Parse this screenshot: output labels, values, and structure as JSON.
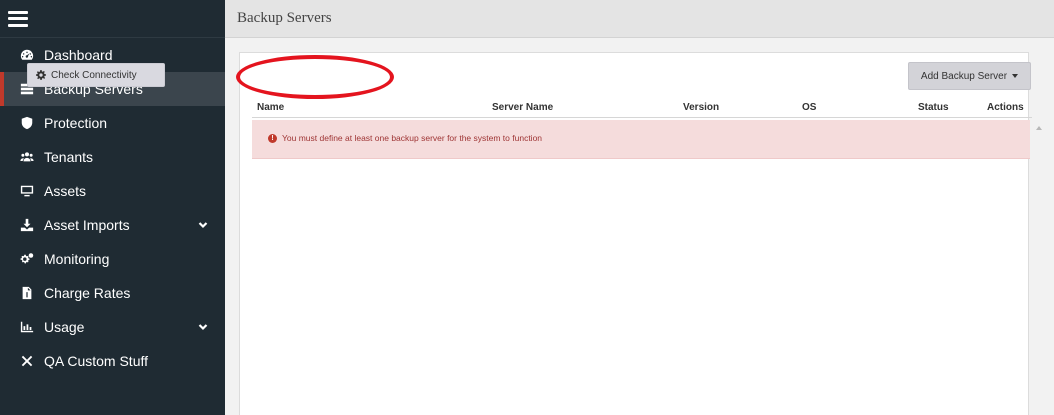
{
  "header": {
    "title": "Backup Servers"
  },
  "sidebar": {
    "items": [
      {
        "label": "Dashboard",
        "icon": "dashboard-icon"
      },
      {
        "label": "Backup Servers",
        "icon": "server-list-icon",
        "active": true
      },
      {
        "label": "Protection",
        "icon": "shield-icon"
      },
      {
        "label": "Tenants",
        "icon": "users-icon"
      },
      {
        "label": "Assets",
        "icon": "monitor-icon"
      },
      {
        "label": "Asset Imports",
        "icon": "download-icon",
        "expandable": true
      },
      {
        "label": "Monitoring",
        "icon": "cogs-icon"
      },
      {
        "label": "Charge Rates",
        "icon": "invoice-icon"
      },
      {
        "label": "Usage",
        "icon": "chart-icon",
        "expandable": true
      },
      {
        "label": "QA Custom Stuff",
        "icon": "tools-icon"
      }
    ]
  },
  "toolbar": {
    "check_label": "Check Connectivity",
    "add_label": "Add Backup Server"
  },
  "table": {
    "columns": [
      "Name",
      "Server Name",
      "Version",
      "OS",
      "Status",
      "Actions"
    ]
  },
  "alert": {
    "message": "You must define at least one backup server for the system to function"
  },
  "colors": {
    "sidebar_bg": "#1f2b33",
    "active_indicator": "#c0392b",
    "alert_bg": "#f5dcdc",
    "highlight_ring": "#e4141e"
  }
}
